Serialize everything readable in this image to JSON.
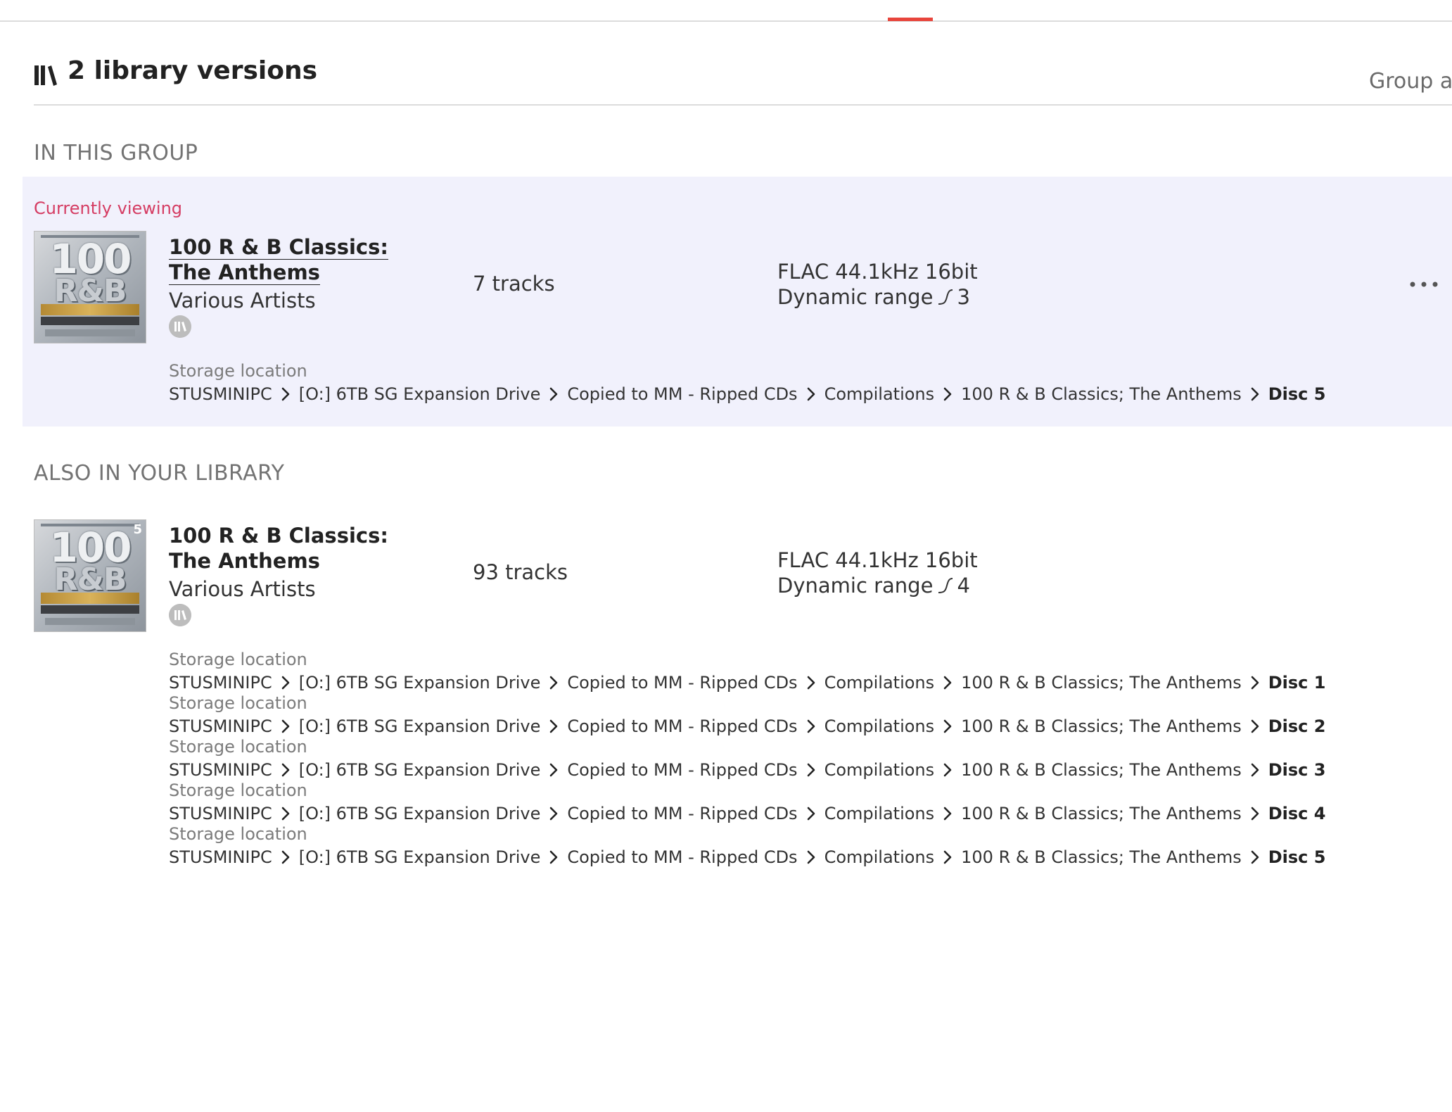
{
  "header": {
    "title": "2 library versions",
    "group_all_label": "Group all"
  },
  "sections": {
    "in_group": "IN THIS GROUP",
    "also_in_library": "ALSO IN YOUR LIBRARY"
  },
  "current": {
    "badge": "Currently viewing",
    "cover": {
      "line1": "100",
      "line2": "R&B"
    },
    "title": "100 R & B Classics: The Anthems",
    "artist": "Various Artists",
    "tracks": "7 tracks",
    "format": "FLAC 44.1kHz 16bit",
    "dynamic_range_label": "Dynamic range",
    "dynamic_range_value": "3",
    "storage_label": "Storage location",
    "path": [
      "STUSMINIPC",
      "[O:] 6TB SG Expansion Drive",
      "Copied to MM - Ripped CDs",
      "Compilations",
      "100 R & B Classics; The Anthems",
      "Disc 5"
    ]
  },
  "other": {
    "cover": {
      "line1": "100",
      "line2": "R&B",
      "badge": "5"
    },
    "title": "100 R & B Classics: The Anthems",
    "artist": "Various Artists",
    "tracks": "93 tracks",
    "format": "FLAC 44.1kHz 16bit",
    "dynamic_range_label": "Dynamic range",
    "dynamic_range_value": "4",
    "storage_label": "Storage location",
    "paths": [
      [
        "STUSMINIPC",
        "[O:] 6TB SG Expansion Drive",
        "Copied to MM - Ripped CDs",
        "Compilations",
        "100 R & B Classics; The Anthems",
        "Disc 1"
      ],
      [
        "STUSMINIPC",
        "[O:] 6TB SG Expansion Drive",
        "Copied to MM - Ripped CDs",
        "Compilations",
        "100 R & B Classics; The Anthems",
        "Disc 2"
      ],
      [
        "STUSMINIPC",
        "[O:] 6TB SG Expansion Drive",
        "Copied to MM - Ripped CDs",
        "Compilations",
        "100 R & B Classics; The Anthems",
        "Disc 3"
      ],
      [
        "STUSMINIPC",
        "[O:] 6TB SG Expansion Drive",
        "Copied to MM - Ripped CDs",
        "Compilations",
        "100 R & B Classics; The Anthems",
        "Disc 4"
      ],
      [
        "STUSMINIPC",
        "[O:] 6TB SG Expansion Drive",
        "Copied to MM - Ripped CDs",
        "Compilations",
        "100 R & B Classics; The Anthems",
        "Disc 5"
      ]
    ]
  },
  "icons": {
    "library": "library-books-icon",
    "chevron": "chevron-right-icon",
    "dynamic_range": "dynamic-range-icon",
    "more": "more-horizontal-icon"
  },
  "colors": {
    "accent": "#e8453c",
    "currently_viewing": "#d53d63",
    "current_panel_bg": "#f1f1fc"
  }
}
